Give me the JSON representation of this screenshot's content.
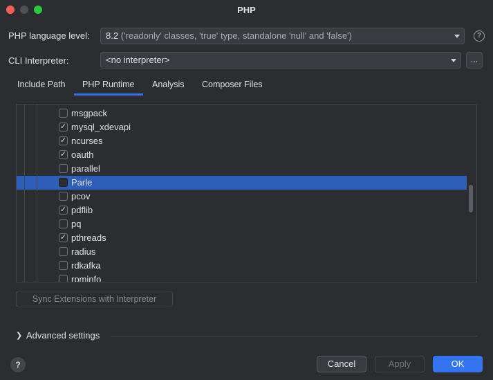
{
  "window": {
    "title": "PHP"
  },
  "language_level": {
    "label": "PHP language level:",
    "version": "8.2",
    "description": "('readonly' classes, 'true' type, standalone 'null' and 'false')"
  },
  "cli": {
    "label": "CLI Interpreter:",
    "value": "<no interpreter>",
    "browse_label": "..."
  },
  "help_glyph": "?",
  "tabs": [
    {
      "label": "Include Path",
      "active": false
    },
    {
      "label": "PHP Runtime",
      "active": true
    },
    {
      "label": "Analysis",
      "active": false
    },
    {
      "label": "Composer Files",
      "active": false
    }
  ],
  "extensions": [
    {
      "name": "msgpack",
      "checked": false,
      "selected": false
    },
    {
      "name": "mysql_xdevapi",
      "checked": true,
      "selected": false
    },
    {
      "name": "ncurses",
      "checked": true,
      "selected": false
    },
    {
      "name": "oauth",
      "checked": true,
      "selected": false
    },
    {
      "name": "parallel",
      "checked": false,
      "selected": false
    },
    {
      "name": "Parle",
      "checked": false,
      "selected": true
    },
    {
      "name": "pcov",
      "checked": false,
      "selected": false
    },
    {
      "name": "pdflib",
      "checked": true,
      "selected": false
    },
    {
      "name": "pq",
      "checked": false,
      "selected": false
    },
    {
      "name": "pthreads",
      "checked": true,
      "selected": false
    },
    {
      "name": "radius",
      "checked": false,
      "selected": false
    },
    {
      "name": "rdkafka",
      "checked": false,
      "selected": false
    },
    {
      "name": "rpminfo",
      "checked": false,
      "selected": false
    }
  ],
  "sync_button": "Sync Extensions with Interpreter",
  "advanced": {
    "label": "Advanced settings"
  },
  "buttons": {
    "cancel": "Cancel",
    "apply": "Apply",
    "ok": "OK"
  },
  "colors": {
    "accent": "#3574f0",
    "selection": "#2e5eb7",
    "background": "#2b2d30"
  }
}
